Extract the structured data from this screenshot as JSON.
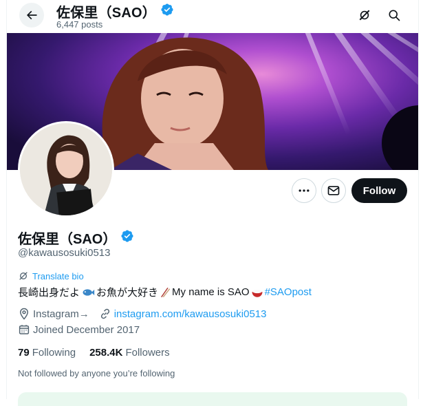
{
  "header": {
    "name": "佐保里（SAO）",
    "post_count": "6,447 posts"
  },
  "profile": {
    "name": "佐保里（SAO）",
    "handle": "@kawausosuki0513",
    "translate_label": "Translate bio",
    "bio_part1": "長崎出身だよ",
    "bio_part2": " お魚が大好き",
    "bio_part3": " My name is SAO",
    "bio_hashtag": " #SAOpost",
    "location": "Instagram→",
    "website": "instagram.com/kawausosuki0513",
    "joined": "Joined December 2017",
    "following_count": "79",
    "following_label": "Following",
    "followers_count": "258.4K",
    "followers_label": "Followers",
    "not_followed": "Not followed by anyone you’re following"
  },
  "actions": {
    "follow_label": "Follow"
  },
  "icons": {
    "back": "back-arrow-icon",
    "grok": "grok-icon",
    "search": "search-icon",
    "more": "more-icon",
    "message": "message-icon",
    "verified": "verified-badge-icon",
    "location": "location-icon",
    "link": "link-icon",
    "calendar": "calendar-icon",
    "translate": "translate-icon"
  },
  "colors": {
    "accent": "#1d9bf0",
    "text": "#0f1419",
    "secondary": "#536471",
    "follow_bg": "#0f1419"
  }
}
